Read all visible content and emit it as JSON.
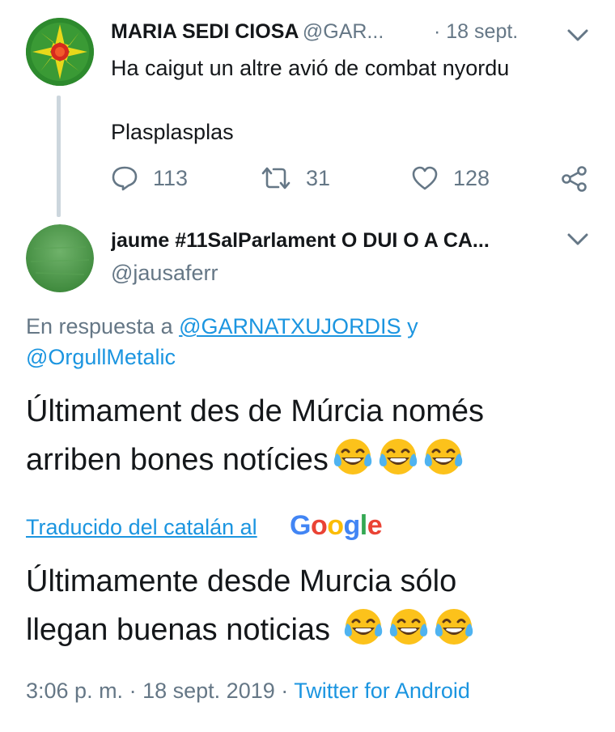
{
  "tweet1": {
    "display_name": "MARIA SEDI CIOSA",
    "handle": "@GAR...",
    "separator": "·",
    "date": "18 sept.",
    "text_line1": "Ha caigut un altre avió de combat nyordu",
    "text_line2": "Plasplasplas",
    "replies": "113",
    "retweets": "31",
    "likes": "128"
  },
  "tweet2": {
    "display_name": "jaume #11SalParlament O DUI O A CA...",
    "handle": "@jausaferr",
    "reply_prefix": "En respuesta a",
    "reply_user1": "@GARNATXUJORDIS",
    "reply_and": "y",
    "reply_user2": "@OrgullMetalic",
    "text_line1": "Últimament des de Múrcia només",
    "text_line2": "arriben bones notícies",
    "translated_label": "Traducido del catalán al",
    "google_logo": "Google",
    "translation_line1": "Últimamente desde Murcia sólo",
    "translation_line2": "llegan buenas noticias",
    "time": "3:06 p. m.",
    "dot": "·",
    "date": "18 sept. 2019",
    "client": "Twitter for Android"
  },
  "colors": {
    "accent": "#1b95e0",
    "secondary_text": "#657786",
    "thread_line": "#ccd6dd"
  },
  "icons": [
    "avatar-1",
    "avatar-2",
    "chevron-down-icon",
    "reply-icon",
    "retweet-icon",
    "like-icon",
    "share-icon",
    "crying-laughing-emoji"
  ]
}
